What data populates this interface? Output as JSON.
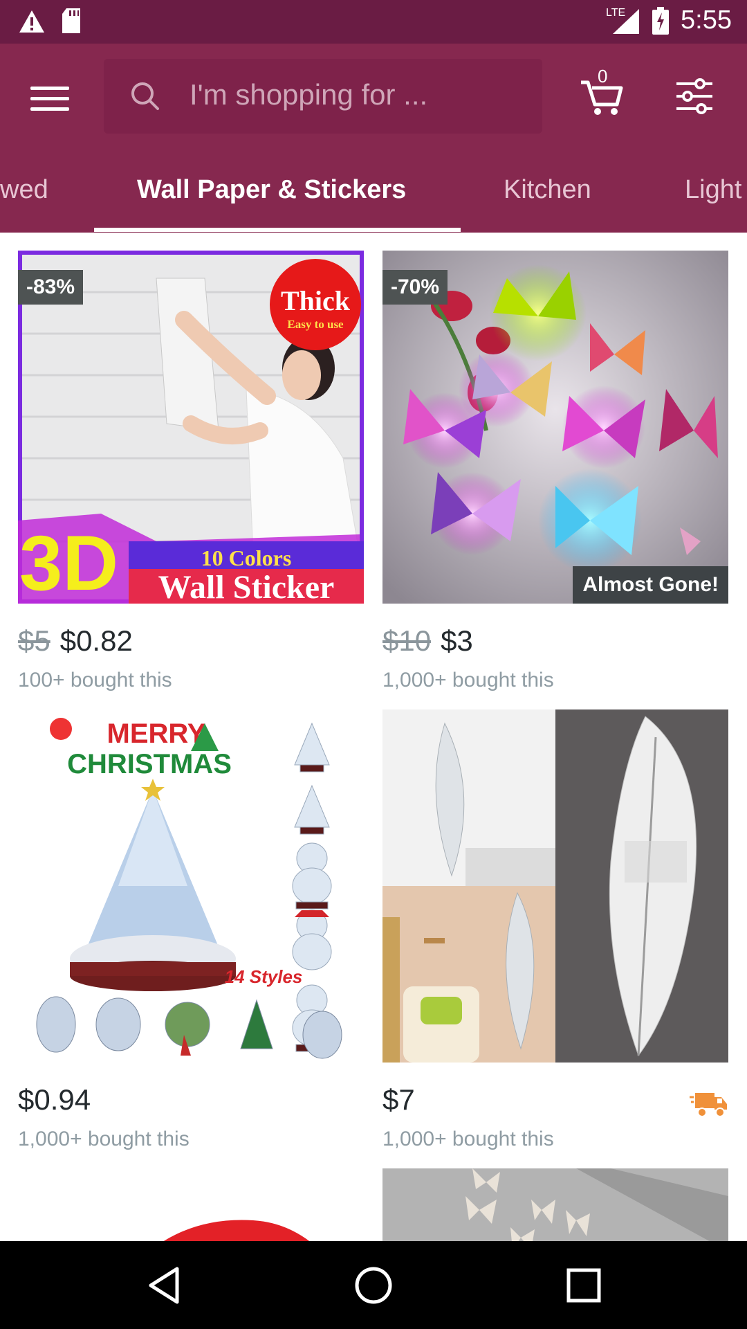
{
  "status_bar": {
    "time": "5:55",
    "network": "LTE"
  },
  "header": {
    "search_placeholder": "I'm shopping for ...",
    "cart_count": "0"
  },
  "tabs": [
    {
      "label": "wed",
      "active": false
    },
    {
      "label": "Wall Paper & Stickers",
      "active": true
    },
    {
      "label": "Kitchen",
      "active": false
    },
    {
      "label": "Light",
      "active": false
    }
  ],
  "products": [
    {
      "discount": "-83%",
      "old_price": "$5",
      "price": "$0.82",
      "bought": "100+ bought this",
      "image_text": {
        "badge_title": "Thick",
        "badge_sub": "Easy to use",
        "big": "3D",
        "colors": "10 Colors",
        "banner": "Wall Sticker"
      }
    },
    {
      "discount": "-70%",
      "old_price": "$10",
      "price": "$3",
      "bought": "1,000+ bought this",
      "tag": "Almost Gone!"
    },
    {
      "price": "$0.94",
      "bought": "1,000+ bought this",
      "image_text": {
        "line1": "MERRY",
        "line2": "CHRISTMAS",
        "styles": "14 Styles"
      }
    },
    {
      "price": "$7",
      "bought": "1,000+ bought this",
      "shipping_icon": "truck-icon"
    }
  ],
  "colors": {
    "status_bar": "#6a1c44",
    "app_bar": "#86284f",
    "discount_badge": "#4e5353",
    "truck": "#f0913a"
  }
}
